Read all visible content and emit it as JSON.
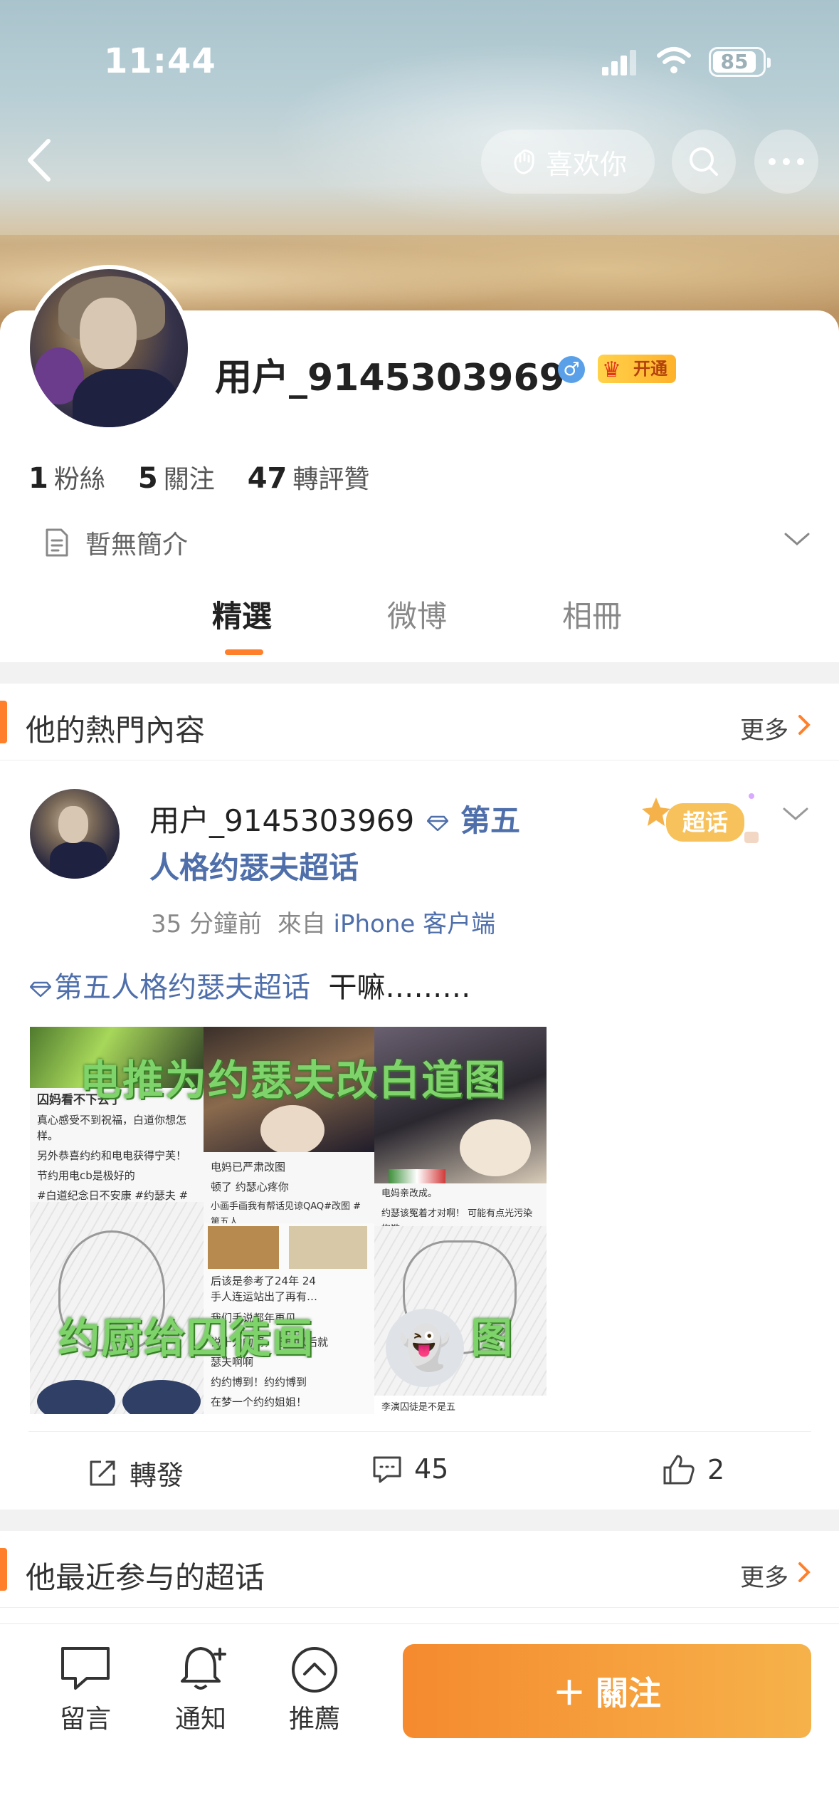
{
  "status_bar": {
    "time": "11:44",
    "battery": "85"
  },
  "header": {
    "like_label": "喜欢你"
  },
  "profile": {
    "username": "用户_9145303969",
    "gender_symbol": "♂",
    "vip_label": "开通",
    "stats": [
      {
        "num": "1",
        "label": "粉絲"
      },
      {
        "num": "5",
        "label": "關注"
      },
      {
        "num": "47",
        "label": "轉評贊"
      }
    ],
    "bio": "暫無簡介"
  },
  "tabs": [
    "精選",
    "微博",
    "相冊"
  ],
  "hot_section": {
    "title": "他的熱門內容",
    "more": "更多"
  },
  "post": {
    "author": "用户_9145303969",
    "topic_line1": "第五",
    "topic_line2": "人格约瑟夫超话",
    "time": "35 分鐘前",
    "source_prefix": "來自",
    "source": "iPhone 客户端",
    "badge": "超话",
    "text_topic": "第五人格约瑟夫超话",
    "text_body": "干嘛………",
    "image_overlay_top": "电推为约瑟夫改白道图",
    "image_overlay_bottom": "约厨给囚徒画",
    "image_overlay_bottom_end": "图",
    "image_texts": {
      "p1_title": "囚妈看不下去了",
      "p1_lines": [
        "真心感受不到祝福，白道你想怎样。",
        "另外恭喜约约和电电获得宁芙！",
        "节约用电cb是极好的",
        "#白道纪念日不安康 #约瑟夫 #改图"
      ],
      "p2_lines": [
        "电妈已严肃改图",
        "顿了 约瑟心疼你",
        "小画手画我有帮话见谅QAQ#改图 #第五人"
      ],
      "p3_lines": [
        "电妈亲改成。",
        "约瑟该冤着才对啊！ 可能有点光污染抱歉。。。"
      ],
      "p4_lines": [
        "后该是参考了24年 24",
        "手人连运站出了再有…",
        "我们手说都年再见",
        "说十力的啊，万一以后就",
        "瑟夫啊啊",
        "约约博到！约约博到",
        "在梦一个约约姐姐！"
      ],
      "p5_lines": [
        "李演囚徒是不是五"
      ]
    },
    "actions": {
      "repost": "轉發",
      "comments": "45",
      "likes": "2"
    }
  },
  "super_section": {
    "title": "他最近参与的超话",
    "more": "更多"
  },
  "bottom_bar": {
    "message": "留言",
    "notify": "通知",
    "recommend": "推薦",
    "follow": "關注",
    "follow_plus": "＋"
  },
  "colors": {
    "accent": "#ff7f2a",
    "link": "#4f6fab",
    "follow_start": "#f58a2e",
    "follow_end": "#f6b24a"
  }
}
